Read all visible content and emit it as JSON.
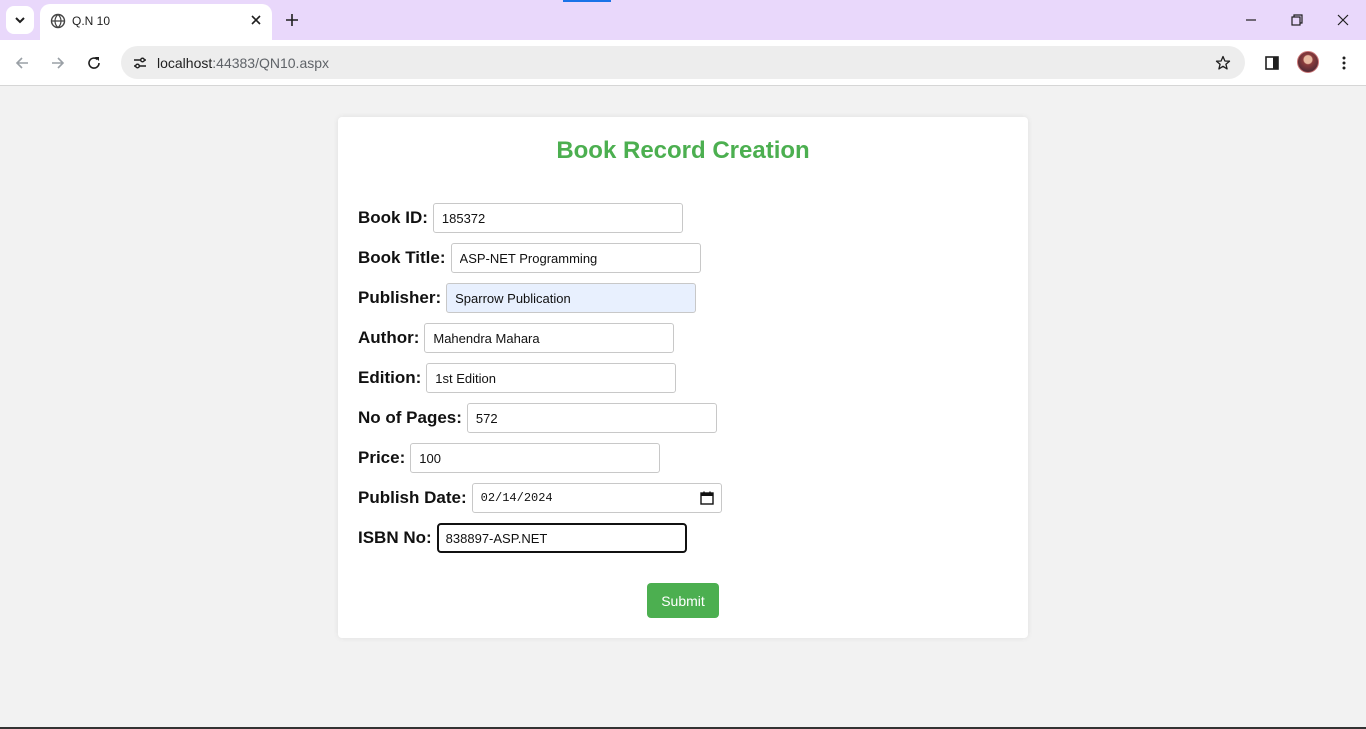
{
  "browser": {
    "tab_title": "Q.N 10",
    "url_host": "localhost",
    "url_path": ":44383/QN10.aspx"
  },
  "form": {
    "title": "Book Record Creation",
    "fields": [
      {
        "label": "Book ID:",
        "value": "185372"
      },
      {
        "label": "Book Title:",
        "value": "ASP-NET Programming"
      },
      {
        "label": "Publisher:",
        "value": "Sparrow Publication"
      },
      {
        "label": "Author:",
        "value": "Mahendra Mahara"
      },
      {
        "label": "Edition:",
        "value": "1st Edition"
      },
      {
        "label": "No of Pages:",
        "value": "572"
      },
      {
        "label": "Price:",
        "value": "100"
      },
      {
        "label": "Publish Date:",
        "value": "02/14/2024"
      },
      {
        "label": "ISBN No:",
        "value": "838897-ASP.NET"
      }
    ],
    "submit_label": "Submit"
  },
  "colors": {
    "accent": "#4caf50",
    "tabstrip": "#e9d8fb",
    "autofill": "#e8f0fe"
  },
  "icons": [
    "tab-search-icon",
    "globe-icon",
    "close-icon",
    "plus-icon",
    "minimize-icon",
    "restore-icon",
    "back-arrow-icon",
    "forward-arrow-icon",
    "reload-icon",
    "site-info-icon",
    "star-icon",
    "side-panel-icon",
    "avatar",
    "kebab-menu-icon",
    "calendar-icon"
  ]
}
